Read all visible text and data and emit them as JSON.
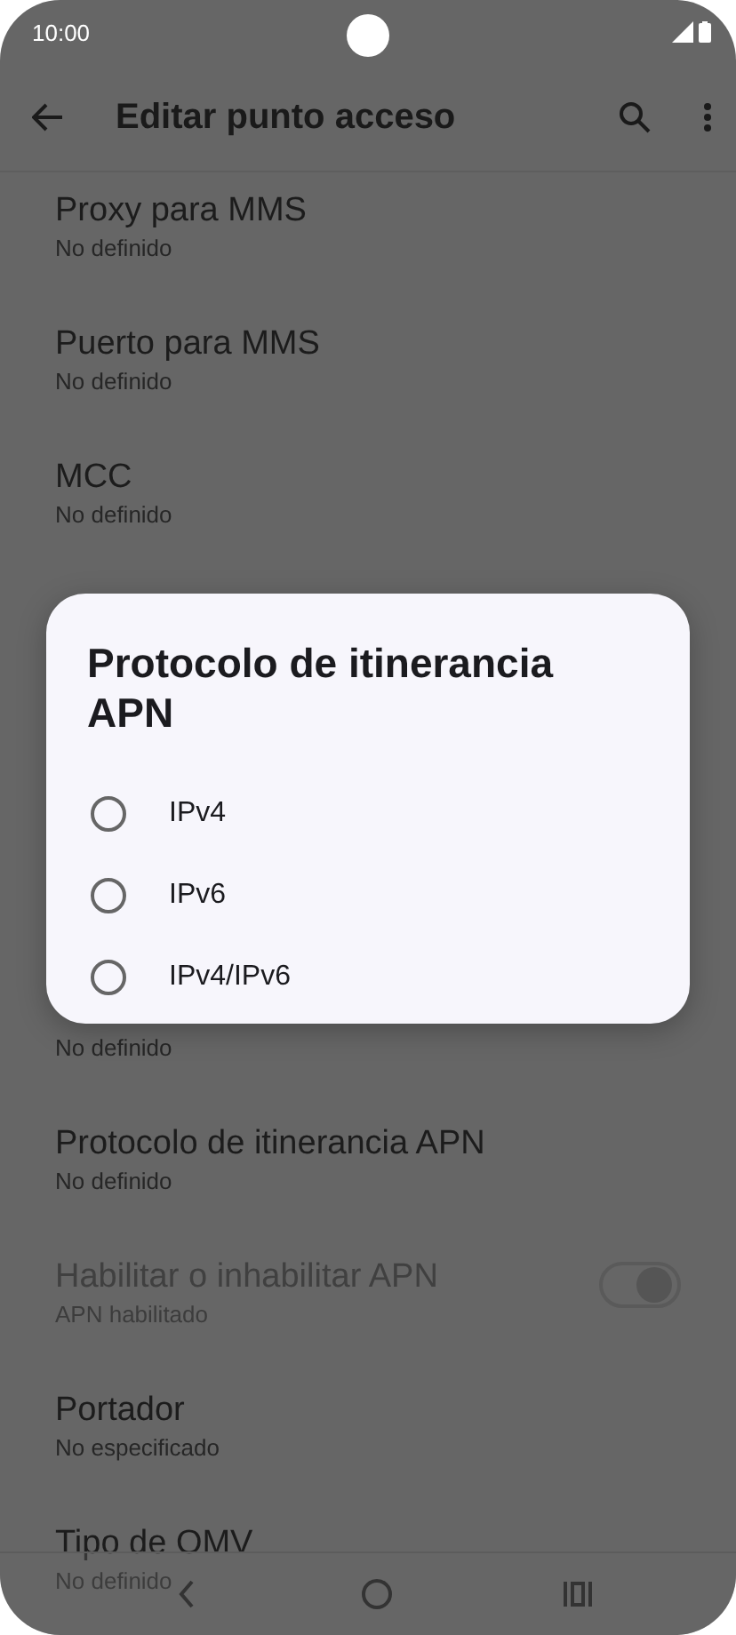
{
  "status_bar": {
    "time": "10:00"
  },
  "app_bar": {
    "title": "Editar punto acceso"
  },
  "settings_above": [
    {
      "title": "Proxy para MMS",
      "summary": "No definido"
    },
    {
      "title": "Puerto para MMS",
      "summary": "No definido"
    },
    {
      "title": "MCC",
      "summary": "No definido"
    }
  ],
  "settings_below": [
    {
      "kind": "text",
      "summary": "No definido",
      "disabled": false
    },
    {
      "kind": "text",
      "title": "Protocolo de itinerancia APN",
      "summary": "No definido",
      "disabled": false
    },
    {
      "kind": "switch",
      "title": "Habilitar o inhabilitar APN",
      "summary": "APN habilitado",
      "disabled": true,
      "on": true
    },
    {
      "kind": "text",
      "title": "Portador",
      "summary": "No especificado",
      "disabled": false
    },
    {
      "kind": "text",
      "title": "Tipo de OMV",
      "summary": "No definido",
      "disabled": false
    }
  ],
  "dialog": {
    "title": "Protocolo de itinerancia APN",
    "options": [
      {
        "label": "IPv4",
        "selected": false
      },
      {
        "label": "IPv6",
        "selected": false
      },
      {
        "label": "IPv4/IPv6",
        "selected": false
      }
    ]
  }
}
